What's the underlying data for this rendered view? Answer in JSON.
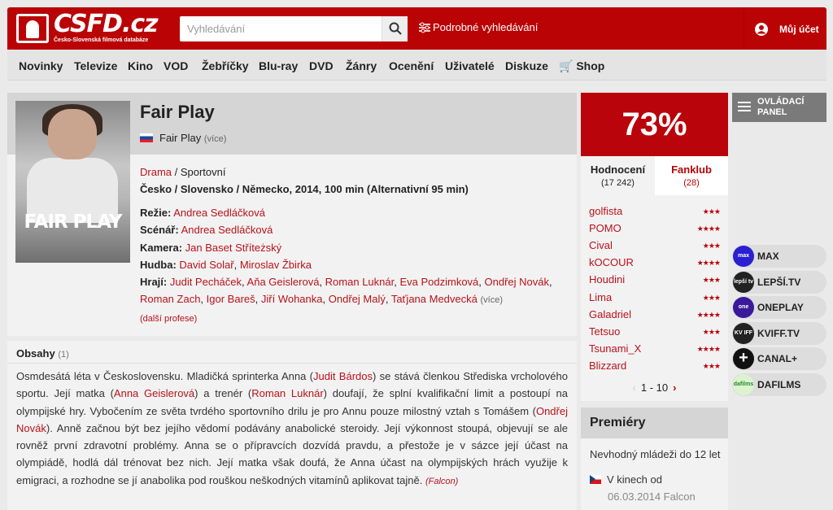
{
  "site": {
    "logo_text": "CSFD.cz",
    "logo_sub": "Česko-Slovenská filmová databáze",
    "search_placeholder": "Vyhledávání",
    "advanced_search": "Podrobné vyhledávání",
    "account": "Můj účet"
  },
  "nav": [
    "Novinky",
    "Televize",
    "Kino",
    "VOD",
    "Žebříčky",
    "Blu-ray",
    "DVD",
    "Žánry",
    "Ocenění",
    "Uživatelé",
    "Diskuze",
    "Shop"
  ],
  "film": {
    "title": "Fair Play",
    "poster_title": "FAIR PLAY",
    "alt_title": "Fair Play",
    "alt_more": "(více)",
    "genre_link": "Drama",
    "genre_rest": " / Sportovní",
    "origin": "Česko / Slovensko / Německo, 2014, 100 min (Alternativní 95 min)",
    "rezie_label": "Režie:",
    "rezie": "Andrea Sedláčková",
    "scenar_label": "Scénář:",
    "scenar": "Andrea Sedláčková",
    "kamera_label": "Kamera:",
    "kamera": "Jan Baset Stříteżský",
    "hudba_label": "Hudba:",
    "hudba1": "David Solař",
    "hudba2": "Miroslav Žbirka",
    "hraji_label": "Hrají:",
    "cast": [
      "Judit Pecháček",
      "Aňa Geislerová",
      "Roman Luknár",
      "Eva Podzimková",
      "Ondřej Novák",
      "Roman Zach",
      "Igor Bareš",
      "Jiří Wohanka",
      "Ondřej Malý",
      "Taťjana Medvecká"
    ],
    "cast_more": "(více)",
    "profese": "(další profese)"
  },
  "obsahy": {
    "title": "Obsahy",
    "count": "(1)",
    "t1": "Osmdesátá léta v Československu. Mladičká sprinterka Anna (",
    "l1": "Judit Bárdos",
    "t2": ") se stává členkou Střediska vrcholového sportu. Její matka (",
    "l2": "Anna Geislerová",
    "t3": ") a trenér (",
    "l3": "Roman Luknár",
    "t4": ") doufají, že splní kvalifikační limit a postoupí na olympijské hry. Vybočením ze světa tvrdého sportovního drilu je pro Annu pouze milostný vztah s Tomášem (",
    "l4": "Ondřej Novák",
    "t5": "). Anně začnou být bez jejího vědomí podávány anabolické steroidy. Její výkonnost stoupá, objevují se ale rovněž první zdravotní problémy. Anna se o příprav­cích dozvídá pravdu, a přestože je v sázce její účast na olympiádě, hodlá dál trénovat bez nich. Její matka však doufá, že Anna účast na olympijských hrách využije k emigraci, a rozhodne se jí anabolika pod rouškou neškodných vitamínů aplikovat tajně. ",
    "src": "(Falcon)"
  },
  "rating": {
    "value": "73%",
    "tab1": "Hodnocení",
    "tab1_count": "(17 242)",
    "tab2": "Fanklub",
    "tab2_count": "(28)",
    "raters": [
      {
        "name": "golfista",
        "stars": "★★★"
      },
      {
        "name": "POMO",
        "stars": "★★★★"
      },
      {
        "name": "Cival",
        "stars": "★★★"
      },
      {
        "name": "kOCOUR",
        "stars": "★★★★"
      },
      {
        "name": "Houdini",
        "stars": "★★★"
      },
      {
        "name": "Lima",
        "stars": "★★★"
      },
      {
        "name": "Galadriel",
        "stars": "★★★★"
      },
      {
        "name": "Tetsuo",
        "stars": "★★★"
      },
      {
        "name": "Tsunami_X",
        "stars": "★★★★"
      },
      {
        "name": "Blizzard",
        "stars": "★★★"
      }
    ],
    "pager": "1 - 10",
    "prev": "‹",
    "next": "›"
  },
  "premiery": {
    "title": "Premiéry",
    "age": "Nevhodný mládeži do 12 let",
    "cinema": "V kinech od",
    "date": "06.03.2014 Falcon"
  },
  "panel": {
    "label1": "OVLÁDACÍ",
    "label2": "PANEL"
  },
  "vod": [
    {
      "name": "MAX",
      "icon": "max",
      "color": "#2a1fd1"
    },
    {
      "name": "LEPŠÍ.TV",
      "icon": "lepší tv",
      "color": "#222"
    },
    {
      "name": "ONEPLAY",
      "icon": "one play",
      "color": "#3a1a9a"
    },
    {
      "name": "KVIFF.TV",
      "icon": "KV IFF TV",
      "color": "#222"
    },
    {
      "name": "CANAL+",
      "icon": "+",
      "color": "#111"
    },
    {
      "name": "DAFILMS",
      "icon": "dafilms",
      "color": "#dbf3d0"
    }
  ]
}
